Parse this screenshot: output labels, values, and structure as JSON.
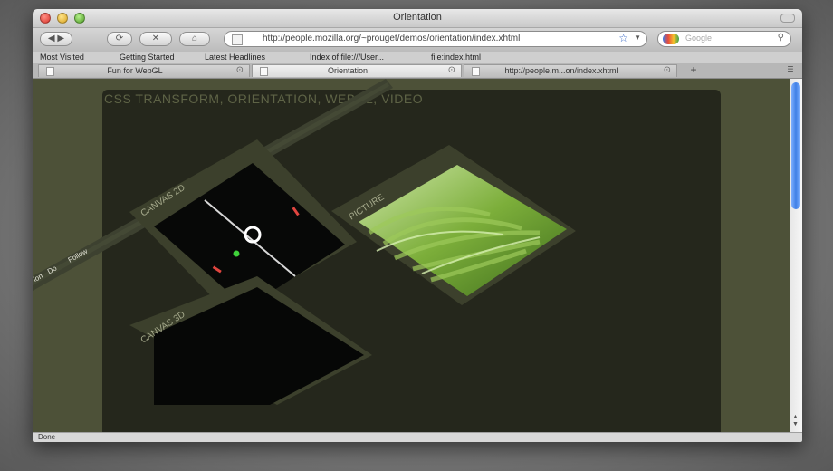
{
  "window": {
    "title": "Orientation"
  },
  "nav": {
    "url": "http://people.mozilla.org/~prouget/demos/orientation/index.xhtml",
    "search_placeholder": "Google"
  },
  "bookmarks": [
    "Most Visited",
    "Getting Started",
    "Latest Headlines",
    "Index of file:///User...",
    "file:index.html"
  ],
  "tabs": [
    {
      "label": "Fun for WebGL"
    },
    {
      "label": "Orientation"
    },
    {
      "label": "http://people.m...on/index.xhtml"
    }
  ],
  "page": {
    "heading": "CSS TRANSFORM, ORIENTATION, WEBGL, VIDEO",
    "menu": [
      "ion",
      "Do",
      "Follow"
    ],
    "canvas2d_label": "CANVAS 2D",
    "canvas3d_label": "CANVAS 3D",
    "picture_label": "PICTURE"
  },
  "status": {
    "text": "Done"
  },
  "colors": {
    "panel": "#25271c",
    "frame": "#4d5138",
    "accent_green": "#3fd23a",
    "accent_red": "#e0453f"
  }
}
